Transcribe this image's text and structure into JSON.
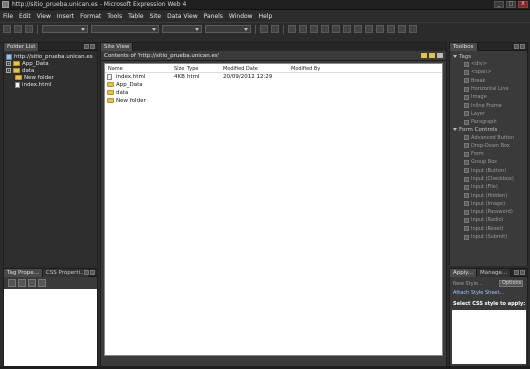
{
  "window": {
    "title": "http://sitio_prueba.unican.es - Microsoft Expression Web 4",
    "buttons": [
      "_",
      "□",
      "X"
    ]
  },
  "menu": [
    "File",
    "Edit",
    "View",
    "Insert",
    "Format",
    "Tools",
    "Table",
    "Site",
    "Data View",
    "Panels",
    "Window",
    "Help"
  ],
  "folder_list": {
    "tab": "Folder List",
    "root": "http://sitio_prueba.unican.es",
    "items": [
      {
        "label": "App_Data",
        "type": "folder",
        "expandable": true
      },
      {
        "label": "data",
        "type": "folder",
        "expandable": true
      },
      {
        "label": "New folder",
        "type": "folder",
        "expandable": false
      },
      {
        "label": "index.html",
        "type": "file",
        "expandable": false
      }
    ]
  },
  "bottom_left": {
    "tabs": [
      "Tag Prope...",
      "CSS Properti..."
    ]
  },
  "site_view": {
    "tab": "Site View",
    "path_label": "Contents of 'http://sitio_prueba.unican.es'",
    "columns": [
      "Name",
      "Size",
      "Type",
      "Modified Date",
      "Modified By"
    ],
    "rows": [
      {
        "name": "index.html",
        "size": "4KB",
        "type": "html",
        "date": "20/09/2012 12:29",
        "by": "",
        "kind": "file"
      },
      {
        "name": "App_Data",
        "size": "",
        "type": "",
        "date": "",
        "by": "",
        "kind": "folder"
      },
      {
        "name": "data",
        "size": "",
        "type": "",
        "date": "",
        "by": "",
        "kind": "folder"
      },
      {
        "name": "New folder",
        "size": "",
        "type": "",
        "date": "",
        "by": "",
        "kind": "folder"
      }
    ]
  },
  "toolbox": {
    "tab": "Toolbox",
    "sections": [
      {
        "title": "Tags",
        "items": [
          "<div>",
          "<span>",
          "Break",
          "Horizontal Line",
          "Image",
          "Inline Frame",
          "Layer",
          "Paragraph"
        ]
      },
      {
        "title": "Form Controls",
        "items": [
          "Advanced Button",
          "Drop-Down Box",
          "Form",
          "Group Box",
          "Input (Button)",
          "Input (Checkbox)",
          "Input (File)",
          "Input (Hidden)",
          "Input (Image)",
          "Input (Password)",
          "Input (Radio)",
          "Input (Reset)",
          "Input (Submit)"
        ]
      }
    ]
  },
  "apply_styles": {
    "tabs": [
      "Apply...",
      "Manage..."
    ],
    "new_style": "New Style...",
    "options": "Options",
    "attach": "Attach Style Sheet...",
    "select_label": "Select CSS style to apply:"
  }
}
